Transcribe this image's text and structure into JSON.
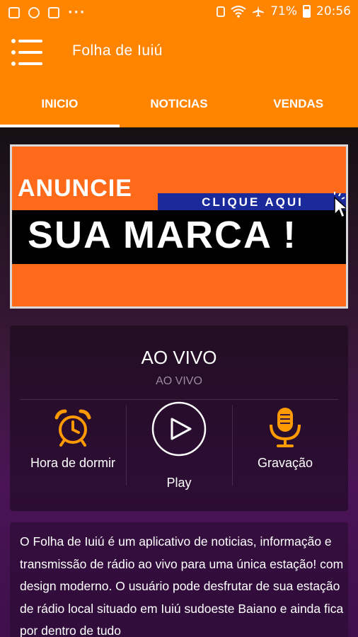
{
  "status_bar": {
    "battery": "71%",
    "time": "20:56",
    "overflow": "···"
  },
  "app_bar": {
    "title": "Folha de Iuiú"
  },
  "tabs": [
    {
      "label": "INICIO",
      "active": true
    },
    {
      "label": "NOTICIAS",
      "active": false
    },
    {
      "label": "VENDAS",
      "active": false
    }
  ],
  "banner": {
    "headline": "ANUNCIE",
    "cta": "CLIQUE AQUI",
    "tagline": "SUA MARCA !"
  },
  "player": {
    "title": "AO VIVO",
    "subtitle": "AO VIVO",
    "controls": [
      {
        "label": "Hora de dormir",
        "icon": "alarm-clock-icon"
      },
      {
        "label": "Play",
        "icon": "play-icon"
      },
      {
        "label": "Gravação",
        "icon": "microphone-icon"
      }
    ]
  },
  "description": {
    "text": "O Folha de Iuiú é um aplicativo de noticias, informação e transmissão de rádio ao vivo para uma única estação! com design moderno. O usuário pode desfrutar de sua estação de rádio local situado em Iuiú sudoeste Baiano e ainda fica por dentro de tudo"
  },
  "colors": {
    "brand_orange": "#ff8400",
    "icon_orange": "#ff9a00",
    "banner_blue": "#1a2a9a"
  }
}
